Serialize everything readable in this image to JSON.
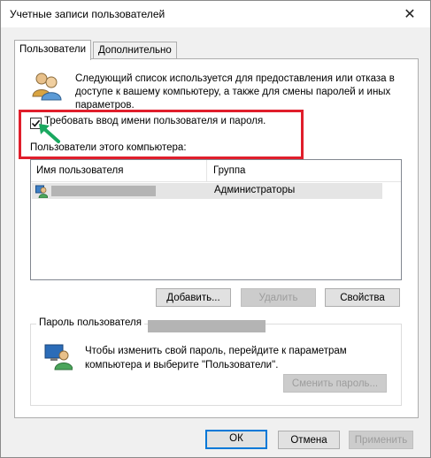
{
  "window": {
    "title": "Учетные записи пользователей",
    "close": "✕"
  },
  "tabs": [
    {
      "label": "Пользователи",
      "active": true
    },
    {
      "label": "Дополнительно",
      "active": false
    }
  ],
  "users_tab": {
    "description": "Следующий список используется для предоставления или отказа в доступе к вашему компьютеру, а также для смены паролей и иных параметров.",
    "require_login": {
      "label": "Требовать ввод имени пользователя и пароля.",
      "checked": true
    },
    "users_caption": "Пользователи этого компьютера:",
    "table": {
      "columns": [
        "Имя пользователя",
        "Группа"
      ],
      "rows": [
        {
          "group": "Администраторы"
        }
      ]
    },
    "buttons": {
      "add": "Добавить...",
      "remove": "Удалить",
      "properties": "Свойства"
    },
    "password_group": {
      "title": "Пароль пользователя",
      "text": "Чтобы изменить свой пароль, перейдите к параметрам компьютера и выберите \"Пользователи\".",
      "change_button": "Сменить пароль..."
    }
  },
  "footer": {
    "ok": "ОК",
    "cancel": "Отмена",
    "apply": "Применить"
  },
  "colors": {
    "highlight": "#e01e2b",
    "arrow": "#1aa860",
    "focus": "#0078d7"
  }
}
